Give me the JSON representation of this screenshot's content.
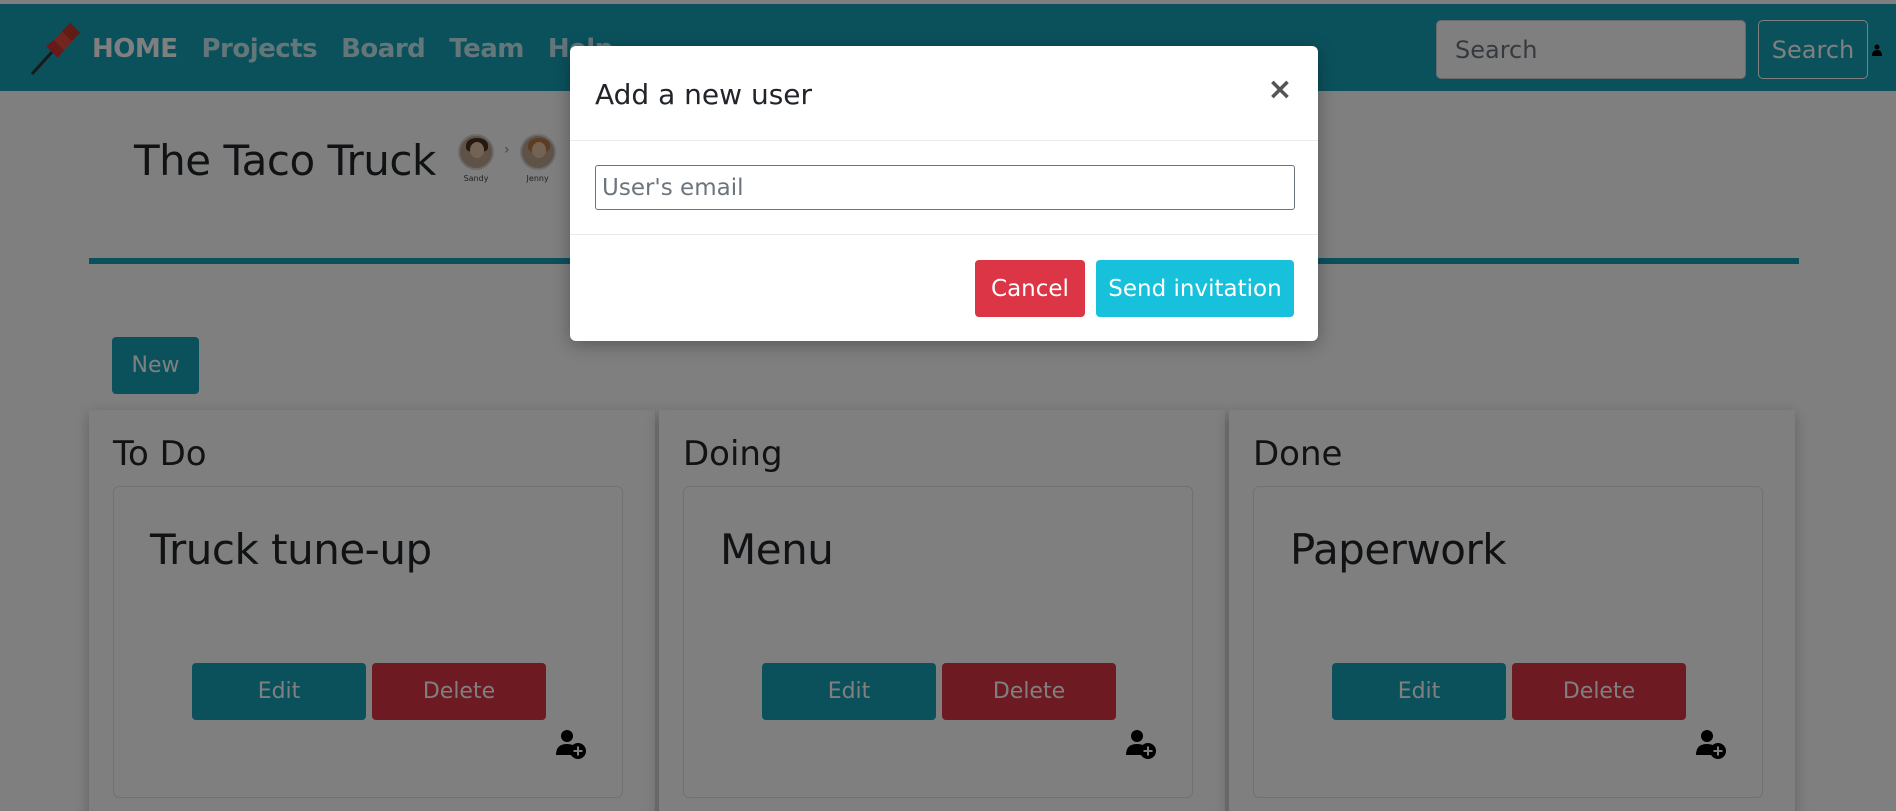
{
  "navbar": {
    "links": [
      "HOME",
      "Projects",
      "Board",
      "Team",
      "Help"
    ],
    "search_placeholder": "Search",
    "search_button": "Search"
  },
  "project": {
    "title": "The Taco Truck",
    "members": [
      {
        "name": "Sandy"
      },
      {
        "name": "Jenny"
      }
    ]
  },
  "toolbar": {
    "new_label": "New"
  },
  "columns": [
    {
      "title": "To Do",
      "card": {
        "title": "Truck tune-up",
        "edit": "Edit",
        "delete": "Delete"
      }
    },
    {
      "title": "Doing",
      "card": {
        "title": "Menu",
        "edit": "Edit",
        "delete": "Delete"
      }
    },
    {
      "title": "Done",
      "card": {
        "title": "Paperwork",
        "edit": "Edit",
        "delete": "Delete"
      }
    }
  ],
  "modal": {
    "title": "Add a new user",
    "close_glyph": "×",
    "email_placeholder": "User's email",
    "cancel_label": "Cancel",
    "send_label": "Send invitation"
  },
  "colors": {
    "primary": "#17a2b8",
    "danger": "#dc3545",
    "info": "#17c1db"
  },
  "icons": {
    "logo": "pushpin-icon",
    "add_user": "add-user-icon",
    "user": "user-icon",
    "close": "close-icon"
  }
}
